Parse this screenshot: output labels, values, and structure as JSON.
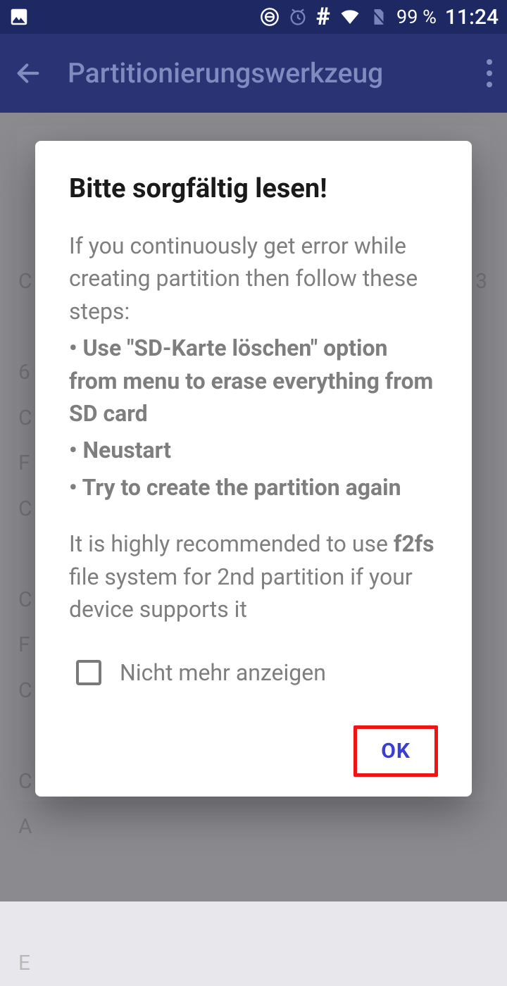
{
  "statusbar": {
    "battery_text": "99 %",
    "time": "11:24"
  },
  "appbar": {
    "title": "Partitionierungswerkzeug"
  },
  "dialog": {
    "title": "Bitte sorgfältig lesen!",
    "intro": "If you continuously get error while creating partition then follow these steps:",
    "step1": "• Use \"SD-Karte löschen\" option from menu to erase everything from SD card",
    "step2": "• Neustart",
    "step3": "• Try to create the partition again",
    "rec_a": "It is highly recommended to use ",
    "rec_b": "f2fs",
    "rec_c": " file system for 2nd partition if your device supports it",
    "checkbox_label": "Nicht mehr anzeigen",
    "ok": "OK"
  }
}
